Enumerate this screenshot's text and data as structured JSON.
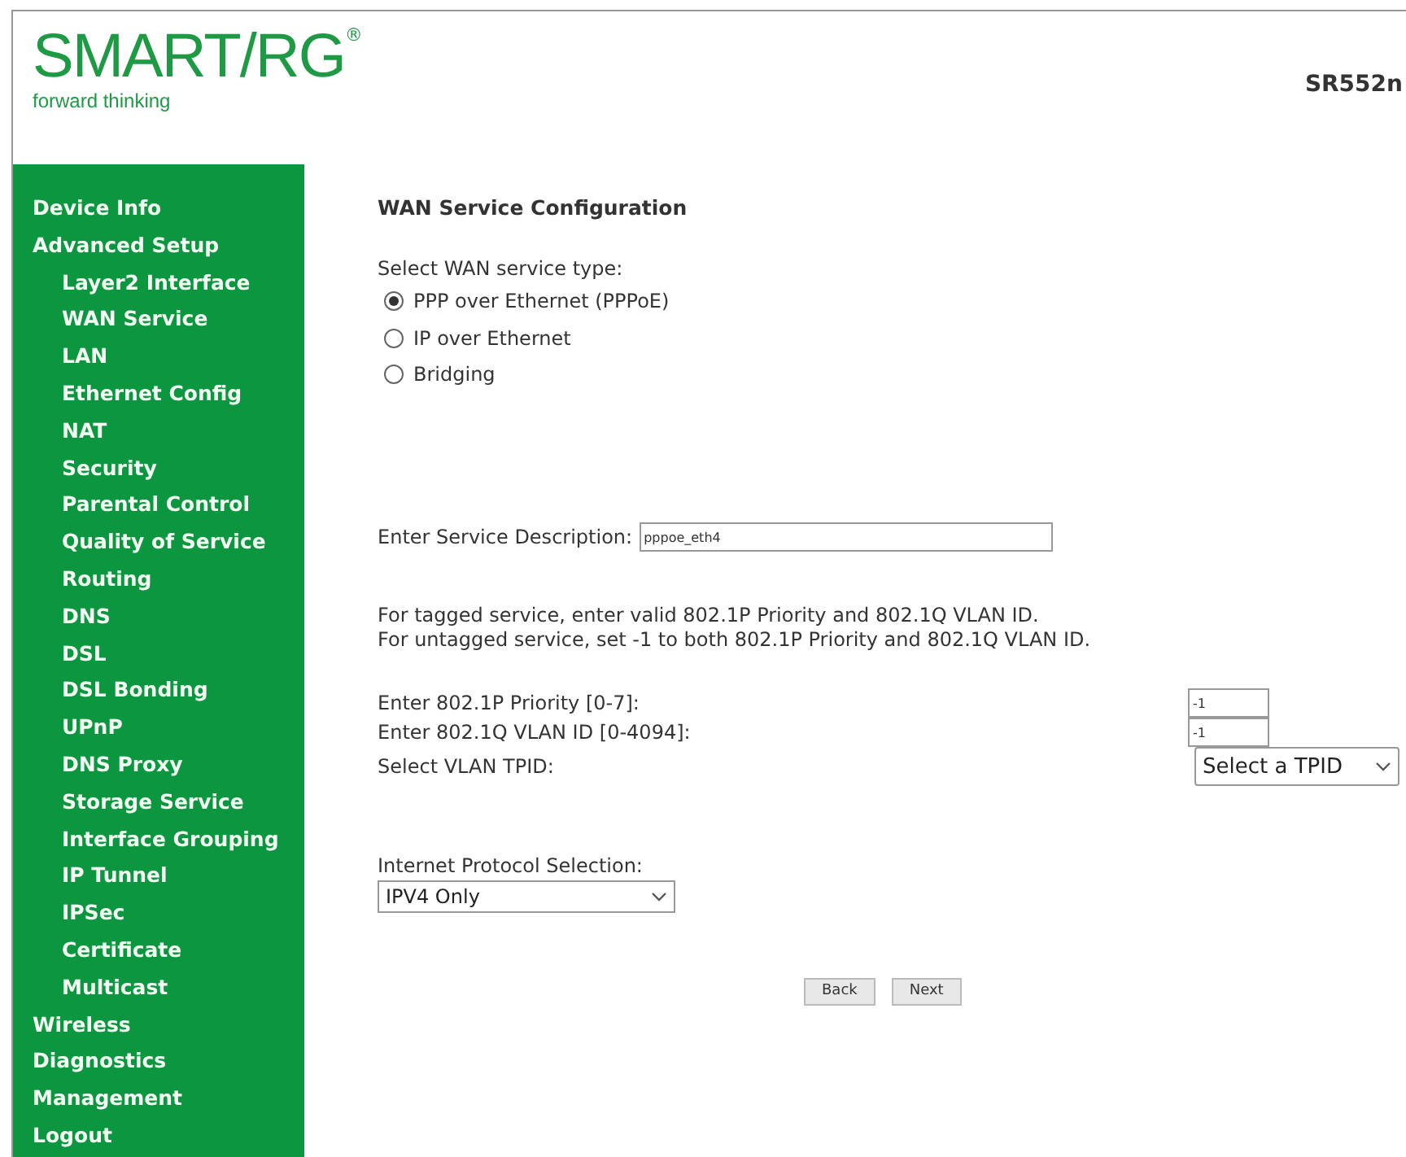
{
  "logo": {
    "brand": "SMART/RG",
    "mark": "®",
    "tagline": "forward thinking"
  },
  "model": "SR552n",
  "sidebar": {
    "items": [
      {
        "label": "Device Info"
      },
      {
        "label": "Advanced Setup",
        "children": [
          {
            "label": "Layer2 Interface"
          },
          {
            "label": "WAN Service"
          },
          {
            "label": "LAN"
          },
          {
            "label": "Ethernet Config"
          },
          {
            "label": "NAT"
          },
          {
            "label": "Security"
          },
          {
            "label": "Parental Control"
          },
          {
            "label": "Quality of Service"
          },
          {
            "label": "Routing"
          },
          {
            "label": "DNS"
          },
          {
            "label": "DSL"
          },
          {
            "label": "DSL Bonding"
          },
          {
            "label": "UPnP"
          },
          {
            "label": "DNS Proxy"
          },
          {
            "label": "Storage Service"
          },
          {
            "label": "Interface Grouping"
          },
          {
            "label": "IP Tunnel"
          },
          {
            "label": "IPSec"
          },
          {
            "label": "Certificate"
          },
          {
            "label": "Multicast"
          }
        ]
      },
      {
        "label": "Wireless"
      },
      {
        "label": "Diagnostics"
      },
      {
        "label": "Management"
      },
      {
        "label": "Logout"
      }
    ]
  },
  "form": {
    "title": "WAN Service Configuration",
    "service_type_label": "Select WAN service type:",
    "service_types": [
      {
        "label": "PPP over Ethernet (PPPoE)",
        "selected": true
      },
      {
        "label": "IP over Ethernet",
        "selected": false
      },
      {
        "label": "Bridging",
        "selected": false
      }
    ],
    "description": {
      "label": "Enter Service Description:",
      "value": "pppoe_eth4"
    },
    "help_lines": [
      "For tagged service, enter valid 802.1P Priority and 802.1Q VLAN ID.",
      "For untagged service, set -1 to both 802.1P Priority and 802.1Q VLAN ID."
    ],
    "priority": {
      "label": "Enter 802.1P Priority [0-7]:",
      "value": "-1"
    },
    "vlan_id": {
      "label": "Enter 802.1Q VLAN ID [0-4094]:",
      "value": "-1"
    },
    "tpid": {
      "label": "Select VLAN TPID:",
      "value": "Select a TPID"
    },
    "protocol": {
      "label": "Internet Protocol Selection:",
      "value": "IPV4 Only"
    },
    "buttons": [
      "Back",
      "Next"
    ]
  }
}
